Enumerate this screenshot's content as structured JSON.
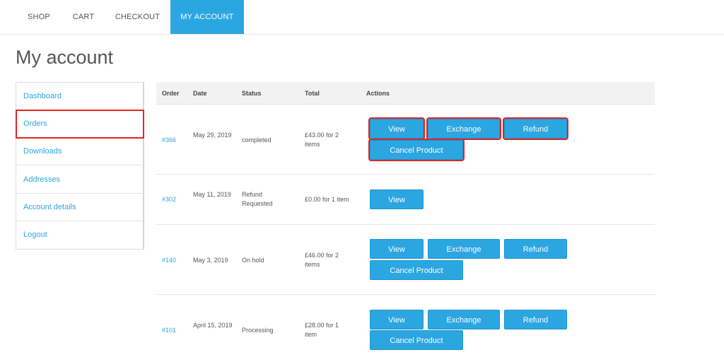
{
  "nav": {
    "items": [
      {
        "label": "SHOP"
      },
      {
        "label": "CART"
      },
      {
        "label": "CHECKOUT"
      },
      {
        "label": "MY ACCOUNT"
      }
    ]
  },
  "page": {
    "title": "My account"
  },
  "sidebar": {
    "items": [
      {
        "label": "Dashboard"
      },
      {
        "label": "Orders"
      },
      {
        "label": "Downloads"
      },
      {
        "label": "Addresses"
      },
      {
        "label": "Account details"
      },
      {
        "label": "Logout"
      }
    ]
  },
  "table": {
    "headers": {
      "order": "Order",
      "date": "Date",
      "status": "Status",
      "total": "Total",
      "actions": "Actions"
    },
    "rows": [
      {
        "order": "#366",
        "date": "May 29, 2019",
        "status": "completed",
        "total": "£43.00 for 2 items",
        "buttons": {
          "view": "View",
          "exchange": "Exchange",
          "refund": "Refund",
          "cancel": "Cancel Product"
        }
      },
      {
        "order": "#302",
        "date": "May 11, 2019",
        "status": "Refund Requested",
        "total": "£0.00 for 1 item",
        "buttons": {
          "view": "View"
        }
      },
      {
        "order": "#140",
        "date": "May 3, 2019",
        "status": "On hold",
        "total": "£46.00 for 2 items",
        "buttons": {
          "view": "View",
          "exchange": "Exchange",
          "refund": "Refund",
          "cancel": "Cancel Product"
        }
      },
      {
        "order": "#101",
        "date": "April 15, 2019",
        "status": "Processing",
        "total": "£28.00 for 1 item",
        "buttons": {
          "view": "View",
          "exchange": "Exchange",
          "refund": "Refund",
          "cancel": "Cancel Product"
        }
      }
    ]
  },
  "colors": {
    "accent": "#2ba6e1",
    "highlight": "#e02424"
  }
}
